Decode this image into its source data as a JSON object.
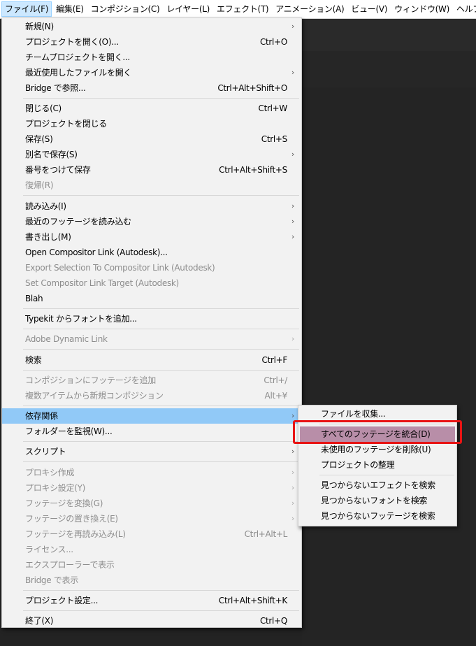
{
  "menubar": [
    {
      "label": "ファイル(F)",
      "active": true
    },
    {
      "label": "編集(E)"
    },
    {
      "label": "コンポジション(C)"
    },
    {
      "label": "レイヤー(L)"
    },
    {
      "label": "エフェクト(T)"
    },
    {
      "label": "アニメーション(A)"
    },
    {
      "label": "ビュー(V)"
    },
    {
      "label": "ウィンドウ(W)"
    },
    {
      "label": "ヘルプ(H)"
    }
  ],
  "file_menu": [
    {
      "label": "新規(N)",
      "submenu": true
    },
    {
      "label": "プロジェクトを開く(O)...",
      "shortcut": "Ctrl+O"
    },
    {
      "label": "チームプロジェクトを開く..."
    },
    {
      "label": "最近使用したファイルを開く",
      "submenu": true
    },
    {
      "label": "Bridge で参照...",
      "shortcut": "Ctrl+Alt+Shift+O"
    },
    {
      "separator": true
    },
    {
      "label": "閉じる(C)",
      "shortcut": "Ctrl+W"
    },
    {
      "label": "プロジェクトを閉じる"
    },
    {
      "label": "保存(S)",
      "shortcut": "Ctrl+S"
    },
    {
      "label": "別名で保存(S)",
      "submenu": true
    },
    {
      "label": "番号をつけて保存",
      "shortcut": "Ctrl+Alt+Shift+S"
    },
    {
      "label": "復帰(R)",
      "disabled": true
    },
    {
      "separator": true
    },
    {
      "label": "読み込み(I)",
      "submenu": true
    },
    {
      "label": "最近のフッテージを読み込む",
      "submenu": true
    },
    {
      "label": "書き出し(M)",
      "submenu": true
    },
    {
      "label": "Open Compositor Link (Autodesk)..."
    },
    {
      "label": "Export Selection To Compositor Link (Autodesk)",
      "disabled": true
    },
    {
      "label": "Set Compositor Link Target (Autodesk)",
      "disabled": true
    },
    {
      "label": "Blah"
    },
    {
      "separator": true
    },
    {
      "label": "Typekit からフォントを追加..."
    },
    {
      "separator": true
    },
    {
      "label": "Adobe Dynamic Link",
      "submenu": true,
      "disabled": true
    },
    {
      "separator": true
    },
    {
      "label": "検索",
      "shortcut": "Ctrl+F"
    },
    {
      "separator": true
    },
    {
      "label": "コンポジションにフッテージを追加",
      "shortcut": "Ctrl+/",
      "disabled": true
    },
    {
      "label": "複数アイテムから新規コンポジション",
      "shortcut": "Alt+¥",
      "disabled": true
    },
    {
      "separator": true
    },
    {
      "label": "依存関係",
      "submenu": true,
      "highlighted": true
    },
    {
      "label": "フォルダーを監視(W)..."
    },
    {
      "separator": true
    },
    {
      "label": "スクリプト",
      "submenu": true
    },
    {
      "separator": true
    },
    {
      "label": "プロキシ作成",
      "submenu": true,
      "disabled": true
    },
    {
      "label": "プロキシ設定(Y)",
      "submenu": true,
      "disabled": true
    },
    {
      "label": "フッテージを変換(G)",
      "submenu": true,
      "disabled": true
    },
    {
      "label": "フッテージの置き換え(E)",
      "submenu": true,
      "disabled": true
    },
    {
      "label": "フッテージを再読み込み(L)",
      "shortcut": "Ctrl+Alt+L",
      "disabled": true
    },
    {
      "label": "ライセンス...",
      "disabled": true
    },
    {
      "label": "エクスプローラーで表示",
      "disabled": true
    },
    {
      "label": "Bridge で表示",
      "disabled": true
    },
    {
      "separator": true
    },
    {
      "label": "プロジェクト設定...",
      "shortcut": "Ctrl+Alt+Shift+K"
    },
    {
      "separator": true
    },
    {
      "label": "終了(X)",
      "shortcut": "Ctrl+Q"
    }
  ],
  "dependencies_submenu": [
    {
      "label": "ファイルを収集..."
    },
    {
      "separator": true
    },
    {
      "label": "すべてのフッテージを統合(D)",
      "selected": true
    },
    {
      "label": "未使用のフッテージを削除(U)"
    },
    {
      "label": "プロジェクトの整理"
    },
    {
      "separator": true
    },
    {
      "label": "見つからないエフェクトを検索"
    },
    {
      "label": "見つからないフォントを検索"
    },
    {
      "label": "見つからないフッテージを検索"
    }
  ],
  "colors": {
    "highlight": "#91c9f7",
    "selected": "#b88ea8",
    "callout": "#e81414"
  }
}
